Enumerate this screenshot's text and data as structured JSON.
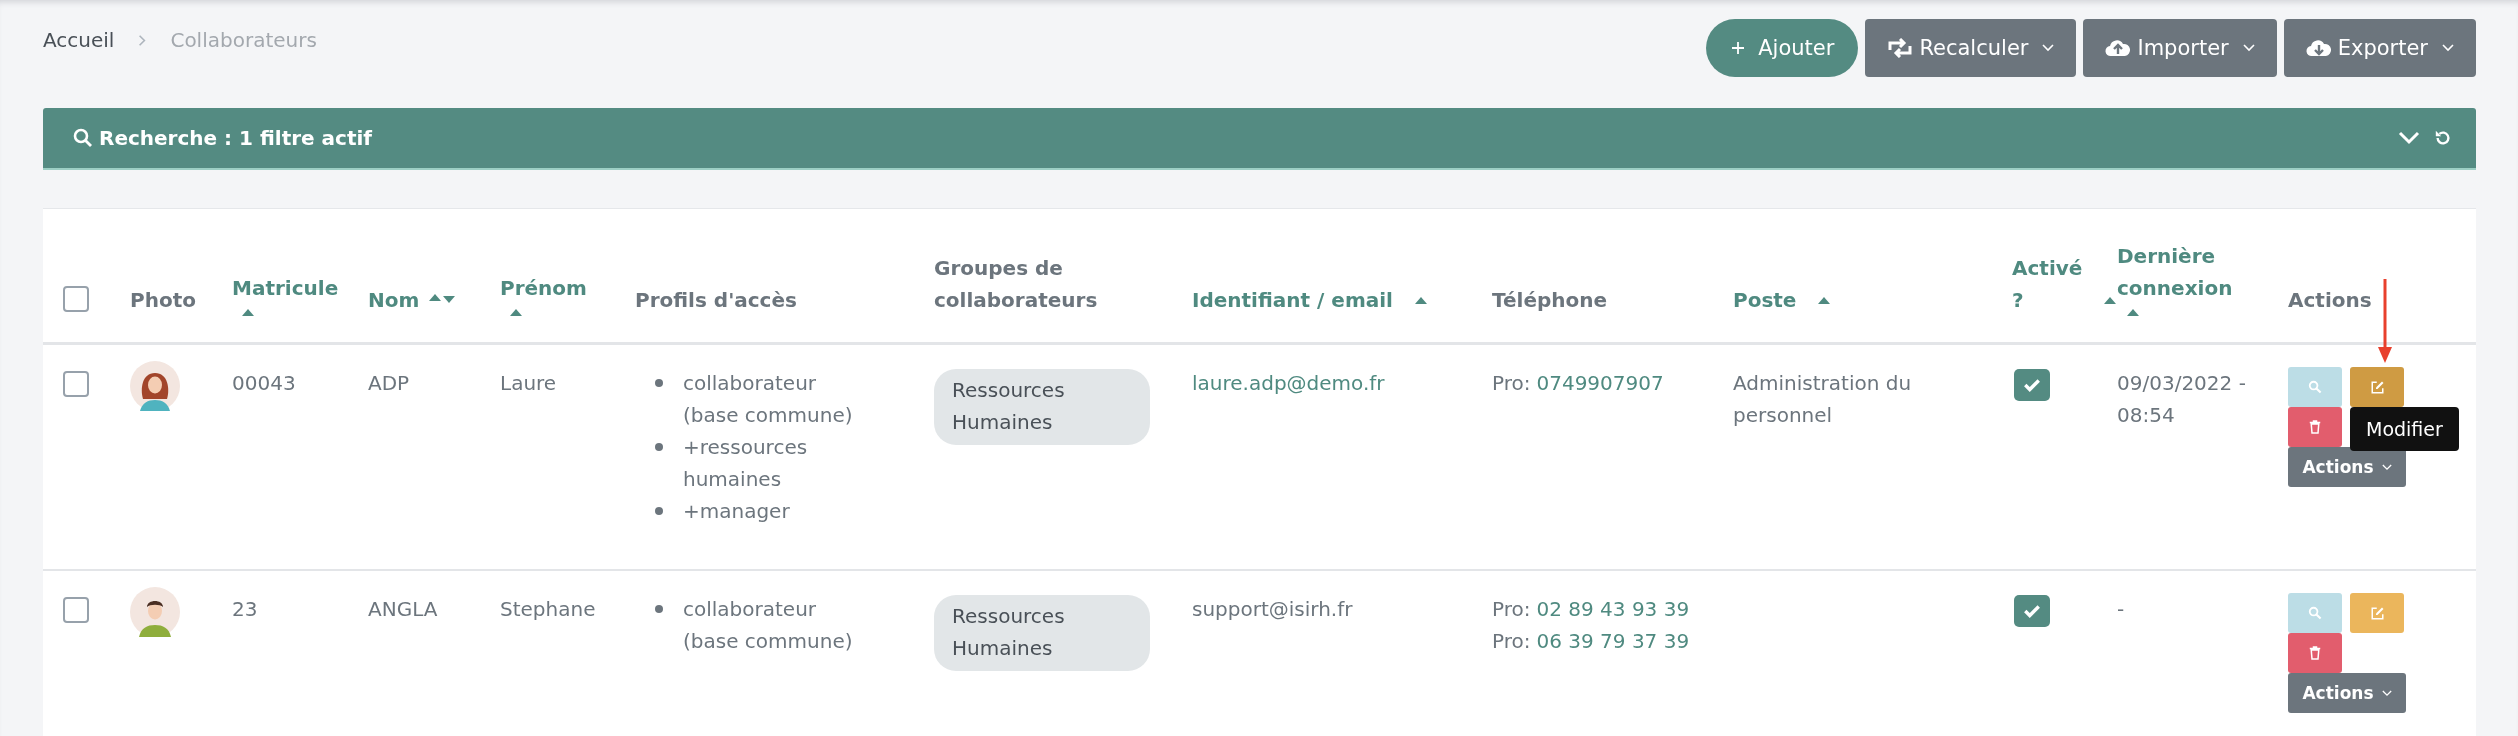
{
  "breadcrumb": [
    {
      "label": "Accueil",
      "current": false
    },
    {
      "label": "Collaborateurs",
      "current": true
    }
  ],
  "toolbar": [
    {
      "kind": "add",
      "label": "Ajouter"
    },
    {
      "kind": "recalc",
      "label": "Recalculer"
    },
    {
      "kind": "import",
      "label": "Importer"
    },
    {
      "kind": "export",
      "label": "Exporter"
    }
  ],
  "search_panel": {
    "title": "Recherche : 1 filtre actif"
  },
  "table": {
    "select_all": {
      "checked": false
    },
    "columns": [
      {
        "label": "Photo",
        "sortable": false
      },
      {
        "label": "Matricule",
        "sortable": true,
        "sort_asc": true,
        "sort_desc": false
      },
      {
        "label": "Nom",
        "sortable": true,
        "sort_asc": true,
        "sort_desc": true
      },
      {
        "label": "Prénom",
        "sortable": true,
        "sort_asc": true,
        "sort_desc": false
      },
      {
        "label": "Profils d'accès",
        "sortable": false
      },
      {
        "label": "Groupes de collaborateurs",
        "sortable": false
      },
      {
        "label": "Identifiant / email",
        "sortable": true,
        "sort_asc": true,
        "sort_desc": false
      },
      {
        "label": "Téléphone",
        "sortable": false
      },
      {
        "label": "Poste",
        "sortable": true,
        "sort_asc": true,
        "sort_desc": false
      },
      {
        "label": "Activé ?",
        "sortable": true,
        "sort_asc": true,
        "sort_desc": false
      },
      {
        "label": "Dernière connexion",
        "sortable": true,
        "sort_asc": true,
        "sort_desc": false
      },
      {
        "label": "Actions",
        "sortable": false
      }
    ],
    "rows": [
      {
        "checked": false,
        "matricule": "00043",
        "nom": "ADP",
        "prenom": "Laure",
        "profils": [
          "collaborateur (base commune)",
          "+ressources humaines",
          "+manager"
        ],
        "groupes": [
          "Ressources Humaines"
        ],
        "email": "laure.adp@demo.fr",
        "email_link": true,
        "phones": [
          {
            "label": "Pro:",
            "number": "0749907907"
          }
        ],
        "poste": "Administration du personnel",
        "active": true,
        "last_login": "09/03/2022 - 08:54",
        "actions_label": "Actions",
        "tooltip": "Modifier"
      },
      {
        "checked": false,
        "matricule": "23",
        "nom": "ANGLA",
        "prenom": "Stephane",
        "profils": [
          "collaborateur (base commune)"
        ],
        "groupes": [
          "Ressources Humaines"
        ],
        "email": "support@isirh.fr",
        "email_link": false,
        "phones": [
          {
            "label": "Pro:",
            "number": "02 89 43 93 39"
          },
          {
            "label": "Pro:",
            "number": "06 39 79 37 39"
          }
        ],
        "active": true,
        "last_login": "-",
        "actions_label": "Actions"
      }
    ]
  }
}
